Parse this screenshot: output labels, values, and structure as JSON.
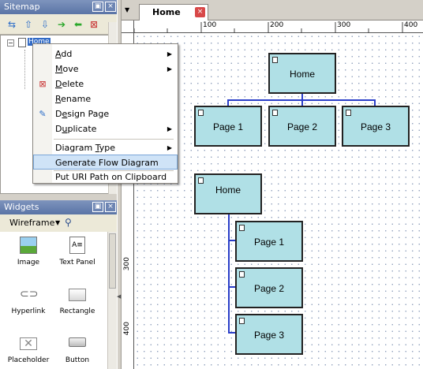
{
  "sitemap": {
    "title": "Sitemap",
    "root_label": "Home"
  },
  "editor": {
    "tab_label": "Home",
    "ruler_h": [
      "100",
      "200",
      "300",
      "400"
    ],
    "ruler_v": [
      "300",
      "400"
    ]
  },
  "diagram1": {
    "root": "Home",
    "children": [
      "Page 1",
      "Page 2",
      "Page 3"
    ]
  },
  "diagram2": {
    "root": "Home",
    "children": [
      "Page 1",
      "Page 2",
      "Page 3"
    ]
  },
  "context_menu": {
    "items": [
      {
        "pre": "",
        "u": "A",
        "post": "dd",
        "submenu": true
      },
      {
        "pre": "",
        "u": "M",
        "post": "ove",
        "submenu": true
      },
      {
        "pre": "",
        "u": "D",
        "post": "elete",
        "submenu": false
      },
      {
        "pre": "",
        "u": "R",
        "post": "ename",
        "submenu": false
      },
      {
        "pre": "D",
        "u": "e",
        "post": "sign Page",
        "submenu": false
      },
      {
        "pre": "D",
        "u": "u",
        "post": "plicate",
        "submenu": true
      },
      {
        "pre": "Diagram ",
        "u": "T",
        "post": "ype",
        "submenu": true
      },
      {
        "pre": "Generate Flow Diagram",
        "u": "",
        "post": "",
        "submenu": false
      },
      {
        "pre": "Put URI Path on Clipboard",
        "u": "",
        "post": "",
        "submenu": false
      }
    ]
  },
  "widgets": {
    "title": "Widgets",
    "library": "Wireframe",
    "items": [
      "Image",
      "Text Panel",
      "Hyperlink",
      "Rectangle",
      "Placeholder",
      "Button"
    ]
  },
  "colors": {
    "node_fill": "#b0e0e6",
    "connector": "#2a3ec8",
    "panel_title": "#6d85b3",
    "menu_highlight": "#cfe3f7"
  }
}
